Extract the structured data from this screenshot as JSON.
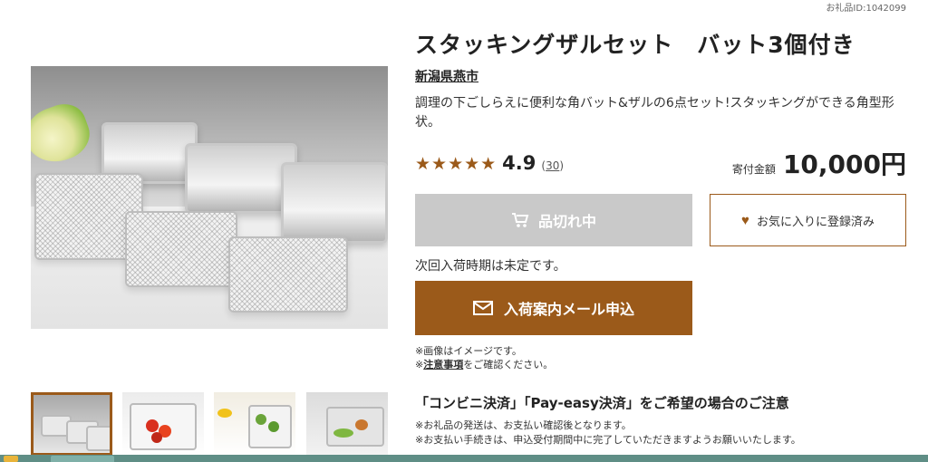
{
  "gift_id": "お礼品ID:1042099",
  "product": {
    "title": "スタッキングザルセット　バット3個付き",
    "city": "新潟県燕市",
    "description": "調理の下ごしらえに便利な角バット&ザルの6点セット!スタッキングができる角型形状。",
    "rating": {
      "stars": "★★★★★",
      "value": "4.9",
      "count": "30"
    },
    "price_label": "寄付金額",
    "price": "10,000円"
  },
  "buttons": {
    "soldout": "品切れ中",
    "favorite": "お気に入りに登録済み",
    "mail": "入荷案内メール申込"
  },
  "restock_text": "次回入荷時期は未定です。",
  "notes": {
    "image_note": "※画像はイメージです。",
    "prefix": "※",
    "link": "注意事項",
    "suffix": "をご確認ください。"
  },
  "payment": {
    "title": "「コンビニ決済」「Pay-easy決済」をご希望の場合のご注意",
    "line1": "※お礼品の発送は、お支払い確認後となります。",
    "line2": "※お支払い手続きは、申込受付期間中に完了していただきますようお願いいたします。"
  },
  "colors": {
    "accent": "#9b5a1a",
    "disabled": "#c9c9c9"
  },
  "icons": [
    "cart-icon",
    "mail-icon",
    "heart-icon"
  ]
}
